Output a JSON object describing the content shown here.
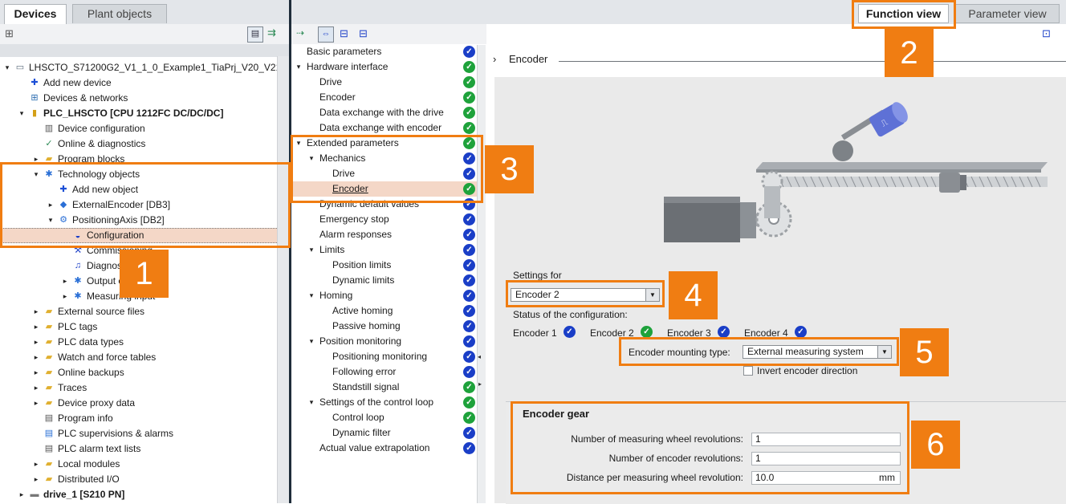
{
  "left_panel": {
    "tabs": [
      "Devices",
      "Plant objects"
    ],
    "tree": [
      {
        "label": "LHSCTO_S71200G2_V1_1_0_Example1_TiaPrj_V20_V21",
        "expander": "▾",
        "icon": "project-icon",
        "glyph": "▭",
        "color": "#5a6b7c",
        "bold": false
      },
      {
        "label": "Add new device",
        "expander": "",
        "icon": "add-device-icon",
        "glyph": "✚",
        "color": "#1c4fd6",
        "bold": false
      },
      {
        "label": "Devices & networks",
        "expander": "",
        "icon": "network-icon",
        "glyph": "⊞",
        "color": "#2b6cb0",
        "bold": false
      },
      {
        "label": "PLC_LHSCTO [CPU 1212FC DC/DC/DC]",
        "expander": "▾",
        "icon": "plc-icon",
        "glyph": "▮",
        "color": "#d4a017",
        "bold": true
      },
      {
        "label": "Device configuration",
        "expander": "",
        "icon": "device-config-icon",
        "glyph": "▥",
        "color": "#555555",
        "bold": false
      },
      {
        "label": "Online & diagnostics",
        "expander": "",
        "icon": "online-diagnostics-icon",
        "glyph": "✓",
        "color": "#2e8b57",
        "bold": false
      },
      {
        "label": "Program blocks",
        "expander": "▸",
        "icon": "folder-icon",
        "glyph": "▰",
        "color": "#e0b030",
        "bold": false
      },
      {
        "label": "Technology objects",
        "expander": "▾",
        "icon": "technology-objects-icon",
        "glyph": "✱",
        "color": "#2a6fd6",
        "bold": false
      },
      {
        "label": "Add new object",
        "expander": "",
        "icon": "add-object-icon",
        "glyph": "✚",
        "color": "#1c4fd6",
        "bold": false
      },
      {
        "label": "ExternalEncoder [DB3]",
        "expander": "▸",
        "icon": "external-encoder-icon",
        "glyph": "◆",
        "color": "#2a6fd6",
        "bold": false
      },
      {
        "label": "PositioningAxis [DB2]",
        "expander": "▾",
        "icon": "positioning-axis-icon",
        "glyph": "⚙",
        "color": "#2a6fd6",
        "bold": false
      },
      {
        "label": "Configuration",
        "expander": "",
        "icon": "configuration-icon",
        "glyph": "◒",
        "color": "#1a3ec7",
        "bold": false
      },
      {
        "label": "Commissioning",
        "expander": "",
        "icon": "commissioning-icon",
        "glyph": "⚒",
        "color": "#1a3ec7",
        "bold": false
      },
      {
        "label": "Diagnostics",
        "expander": "",
        "icon": "diagnostics-icon",
        "glyph": "♫",
        "color": "#1a3ec7",
        "bold": false
      },
      {
        "label": "Output cam",
        "expander": "▸",
        "icon": "output-cam-icon",
        "glyph": "✱",
        "color": "#2a6fd6",
        "bold": false
      },
      {
        "label": "Measuring input",
        "expander": "▸",
        "icon": "measuring-input-icon",
        "glyph": "✱",
        "color": "#2a6fd6",
        "bold": false
      },
      {
        "label": "External source files",
        "expander": "▸",
        "icon": "folder-icon",
        "glyph": "▰",
        "color": "#e0b030",
        "bold": false
      },
      {
        "label": "PLC tags",
        "expander": "▸",
        "icon": "plc-tags-icon",
        "glyph": "▰",
        "color": "#e0b030",
        "bold": false
      },
      {
        "label": "PLC data types",
        "expander": "▸",
        "icon": "plc-data-types-icon",
        "glyph": "▰",
        "color": "#e0b030",
        "bold": false
      },
      {
        "label": "Watch and force tables",
        "expander": "▸",
        "icon": "watch-tables-icon",
        "glyph": "▰",
        "color": "#e0b030",
        "bold": false
      },
      {
        "label": "Online backups",
        "expander": "▸",
        "icon": "online-backups-icon",
        "glyph": "▰",
        "color": "#e0b030",
        "bold": false
      },
      {
        "label": "Traces",
        "expander": "▸",
        "icon": "traces-icon",
        "glyph": "▰",
        "color": "#e0b030",
        "bold": false
      },
      {
        "label": "Device proxy data",
        "expander": "▸",
        "icon": "device-proxy-icon",
        "glyph": "▰",
        "color": "#e0b030",
        "bold": false
      },
      {
        "label": "Program info",
        "expander": "",
        "icon": "program-info-icon",
        "glyph": "▤",
        "color": "#555555",
        "bold": false
      },
      {
        "label": "PLC supervisions & alarms",
        "expander": "",
        "icon": "plc-alarms-icon",
        "glyph": "▤",
        "color": "#2a6fd6",
        "bold": false
      },
      {
        "label": "PLC alarm text lists",
        "expander": "",
        "icon": "alarm-text-lists-icon",
        "glyph": "▤",
        "color": "#555555",
        "bold": false
      },
      {
        "label": "Local modules",
        "expander": "▸",
        "icon": "local-modules-icon",
        "glyph": "▰",
        "color": "#e0b030",
        "bold": false
      },
      {
        "label": "Distributed I/O",
        "expander": "▸",
        "icon": "distributed-io-icon",
        "glyph": "▰",
        "color": "#e0b030",
        "bold": false
      },
      {
        "label": "drive_1 [S210 PN]",
        "expander": "▸",
        "icon": "drive-icon",
        "glyph": "▬",
        "color": "#777777",
        "bold": true
      }
    ]
  },
  "right_tabs": [
    "Function view",
    "Parameter view"
  ],
  "nav": [
    {
      "label": "Basic parameters",
      "expander": "",
      "status": "blue"
    },
    {
      "label": "Hardware interface",
      "expander": "▾",
      "status": "green"
    },
    {
      "label": "Drive",
      "expander": "",
      "status": "green"
    },
    {
      "label": "Encoder",
      "expander": "",
      "status": "green"
    },
    {
      "label": "Data exchange with the drive",
      "expander": "",
      "status": "green"
    },
    {
      "label": "Data exchange with encoder",
      "expander": "",
      "status": "green"
    },
    {
      "label": "Extended parameters",
      "expander": "▾",
      "status": "green"
    },
    {
      "label": "Mechanics",
      "expander": "▾",
      "status": "blue"
    },
    {
      "label": "Drive",
      "expander": "",
      "status": "blue"
    },
    {
      "label": "Encoder",
      "expander": "",
      "status": "green"
    },
    {
      "label": "Dynamic default values",
      "expander": "",
      "status": "blue"
    },
    {
      "label": "Emergency stop",
      "expander": "",
      "status": "blue"
    },
    {
      "label": "Alarm responses",
      "expander": "",
      "status": "blue"
    },
    {
      "label": "Limits",
      "expander": "▾",
      "status": "blue"
    },
    {
      "label": "Position limits",
      "expander": "",
      "status": "blue"
    },
    {
      "label": "Dynamic limits",
      "expander": "",
      "status": "blue"
    },
    {
      "label": "Homing",
      "expander": "▾",
      "status": "blue"
    },
    {
      "label": "Active homing",
      "expander": "",
      "status": "blue"
    },
    {
      "label": "Passive homing",
      "expander": "",
      "status": "blue"
    },
    {
      "label": "Position monitoring",
      "expander": "▾",
      "status": "blue"
    },
    {
      "label": "Positioning monitoring",
      "expander": "",
      "status": "blue"
    },
    {
      "label": "Following error",
      "expander": "",
      "status": "blue"
    },
    {
      "label": "Standstill signal",
      "expander": "",
      "status": "green"
    },
    {
      "label": "Settings of the control loop",
      "expander": "▾",
      "status": "green"
    },
    {
      "label": "Control loop",
      "expander": "",
      "status": "green"
    },
    {
      "label": "Dynamic filter",
      "expander": "",
      "status": "blue"
    },
    {
      "label": "Actual value extrapolation",
      "expander": "",
      "status": "blue"
    }
  ],
  "breadcrumb": {
    "arrow": "›",
    "title": "Encoder"
  },
  "settings": {
    "settings_for_label": "Settings for",
    "settings_for_value": "Encoder 2",
    "status_label": "Status of the configuration:",
    "encoders": [
      {
        "label": "Encoder 1",
        "status": "blue"
      },
      {
        "label": "Encoder 2",
        "status": "green"
      },
      {
        "label": "Encoder 3",
        "status": "blue"
      },
      {
        "label": "Encoder 4",
        "status": "blue"
      }
    ],
    "mounting_label": "Encoder mounting type:",
    "mounting_value": "External measuring system",
    "invert_label": "Invert encoder direction",
    "invert_checked": false
  },
  "encoder_gear": {
    "title": "Encoder gear",
    "rows": [
      {
        "label": "Number of measuring wheel revolutions:",
        "value": "1",
        "unit": ""
      },
      {
        "label": "Number of encoder revolutions:",
        "value": "1",
        "unit": ""
      },
      {
        "label": "Distance per measuring wheel revolution:",
        "value": "10.0",
        "unit": "mm"
      }
    ]
  },
  "callouts": [
    "1",
    "2",
    "3",
    "4",
    "5",
    "6"
  ],
  "colors": {
    "accent": "#f07d12",
    "ok": "#1ea23b",
    "info": "#1a3ec7",
    "selection": "#f4d7c7"
  }
}
